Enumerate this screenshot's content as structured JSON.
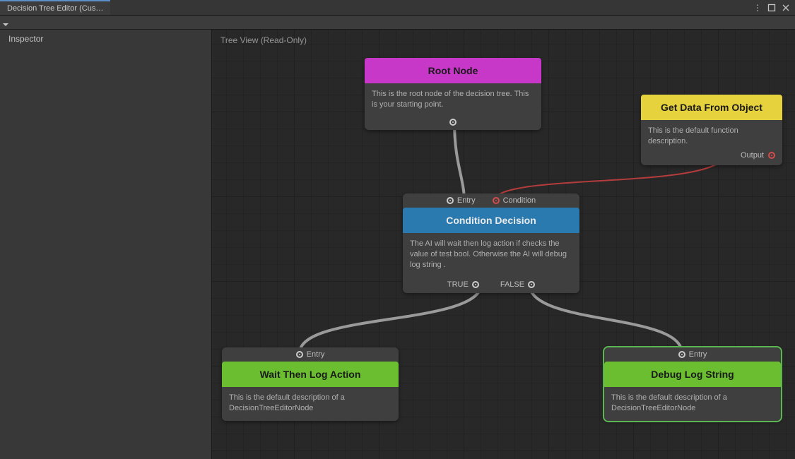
{
  "window": {
    "tabTitle": "Decision Tree Editor (Cus…"
  },
  "inspector": {
    "title": "Inspector"
  },
  "canvas": {
    "label": "Tree View (Read-Only)"
  },
  "nodes": {
    "root": {
      "title": "Root Node",
      "description": "This is the root node of the decision tree. This is your starting point."
    },
    "getData": {
      "title": "Get Data From Object",
      "description": "This is the default function description.",
      "outputLabel": "Output"
    },
    "condition": {
      "entryLabel": "Entry",
      "conditionLabel": "Condition",
      "title": "Condition Decision",
      "description": "The AI will wait then log action  if checks the value of test bool. Otherwise the AI will debug log string .",
      "trueLabel": "TRUE",
      "falseLabel": "FALSE"
    },
    "waitLog": {
      "entryLabel": "Entry",
      "title": "Wait Then Log Action",
      "description": "This is the default description of a DecisionTreeEditorNode"
    },
    "debugLog": {
      "entryLabel": "Entry",
      "title": "Debug Log String",
      "description": "This is the default description of a DecisionTreeEditorNode"
    }
  }
}
